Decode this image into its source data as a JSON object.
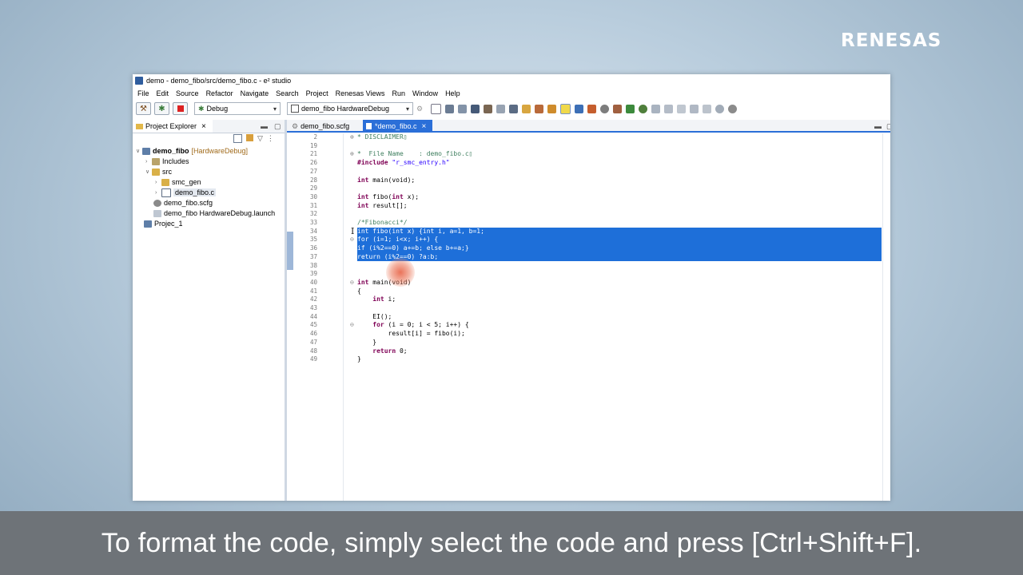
{
  "logo": {
    "text": "RENESAS"
  },
  "window": {
    "title": "demo - demo_fibo/src/demo_fibo.c - e² studio"
  },
  "menu": [
    "File",
    "Edit",
    "Source",
    "Refactor",
    "Navigate",
    "Search",
    "Project",
    "Renesas Views",
    "Run",
    "Window",
    "Help"
  ],
  "toolbar": {
    "build_config": "Debug",
    "launch_config": "demo_fibo HardwareDebug"
  },
  "explorer": {
    "tab_label": "Project Explorer",
    "tree": [
      {
        "label": "demo_fibo",
        "suffix": "[HardwareDebug]",
        "level": 0,
        "icon": "project-icon",
        "expanded": true
      },
      {
        "label": "Includes",
        "level": 1,
        "icon": "includes-icon",
        "expanded": false
      },
      {
        "label": "src",
        "level": 1,
        "icon": "folder-icon",
        "expanded": true
      },
      {
        "label": "smc_gen",
        "level": 2,
        "icon": "folder-icon",
        "expanded": false
      },
      {
        "label": "demo_fibo.c",
        "level": 2,
        "icon": "c-file-icon",
        "expanded": false
      },
      {
        "label": "demo_fibo.scfg",
        "level": 1,
        "icon": "gear-file-icon"
      },
      {
        "label": "demo_fibo HardwareDebug.launch",
        "level": 1,
        "icon": "launch-file-icon"
      },
      {
        "label": "Projec_1",
        "level": 0,
        "icon": "project-icon"
      }
    ]
  },
  "editor": {
    "tabs": [
      {
        "label": "demo_fibo.scfg",
        "active": false
      },
      {
        "label": "*demo_fibo.c",
        "active": true
      }
    ],
    "lines": [
      {
        "n": "2",
        "fold": "⊕",
        "text": "* DISCLAIMER▯"
      },
      {
        "n": "19",
        "text": ""
      },
      {
        "n": "21",
        "fold": "⊕",
        "text": "*  File Name    : demo_fibo.c▯"
      },
      {
        "n": "26",
        "text": "#include \"r_smc_entry.h\""
      },
      {
        "n": "27",
        "text": ""
      },
      {
        "n": "28",
        "text": "int main(void);"
      },
      {
        "n": "29",
        "text": ""
      },
      {
        "n": "30",
        "text": "int fibo(int x);"
      },
      {
        "n": "31",
        "text": "int result[];"
      },
      {
        "n": "32",
        "text": ""
      },
      {
        "n": "33",
        "text": "/*Fibonacci*/"
      },
      {
        "n": "34",
        "text": "int fibo(int x) {int i, a=1, b=1;"
      },
      {
        "n": "35",
        "fold": "⊖",
        "text": "for (i=1; i<x; i++) {"
      },
      {
        "n": "36",
        "text": "if (i%2==0) a+=b; else b+=a;}"
      },
      {
        "n": "37",
        "text": "return (i%2==0) ?a:b;"
      },
      {
        "n": "38",
        "text": "}"
      },
      {
        "n": "39",
        "text": ""
      },
      {
        "n": "40",
        "fold": "⊖",
        "text": "int main(void)"
      },
      {
        "n": "41",
        "text": "{"
      },
      {
        "n": "42",
        "text": "    int i;"
      },
      {
        "n": "43",
        "text": ""
      },
      {
        "n": "44",
        "text": "    EI();"
      },
      {
        "n": "45",
        "fold": "⊖",
        "text": "    for (i = 0; i < 5; i++) {"
      },
      {
        "n": "46",
        "text": "        result[i] = fibo(i);"
      },
      {
        "n": "47",
        "text": "    }"
      },
      {
        "n": "48",
        "text": "    return 0;"
      },
      {
        "n": "49",
        "text": "}"
      }
    ],
    "selected_lines": [
      "34",
      "35",
      "36",
      "37",
      "38"
    ]
  },
  "caption": {
    "text": "To format the code, simply select the code and press [Ctrl+Shift+F]."
  },
  "colors": {
    "selection": "#1e6fd9",
    "keyword": "#7f0055",
    "string": "#2a00ff",
    "comment": "#3f7f5f"
  }
}
